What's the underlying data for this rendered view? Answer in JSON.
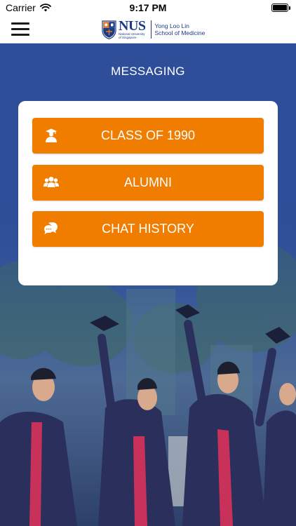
{
  "status_bar": {
    "carrier": "Carrier",
    "time": "9:17 PM"
  },
  "nav": {
    "menu_icon": "hamburger-menu-icon",
    "logo": {
      "brand": "NUS",
      "sub_line_1": "National University",
      "sub_line_2": "of Singapore",
      "school_line_1": "Yong Loo Lin",
      "school_line_2": "School of Medicine"
    }
  },
  "main": {
    "title": "MESSAGING",
    "buttons": [
      {
        "label": "CLASS OF 1990",
        "icon": "graduate-icon"
      },
      {
        "label": "ALUMNI",
        "icon": "group-icon"
      },
      {
        "label": "CHAT HISTORY",
        "icon": "chat-bubbles-icon"
      }
    ]
  },
  "colors": {
    "accent": "#f07c00",
    "brand_blue": "#1a3c82",
    "hero_blue": "#2e4e9a",
    "card": "#ffffff"
  }
}
